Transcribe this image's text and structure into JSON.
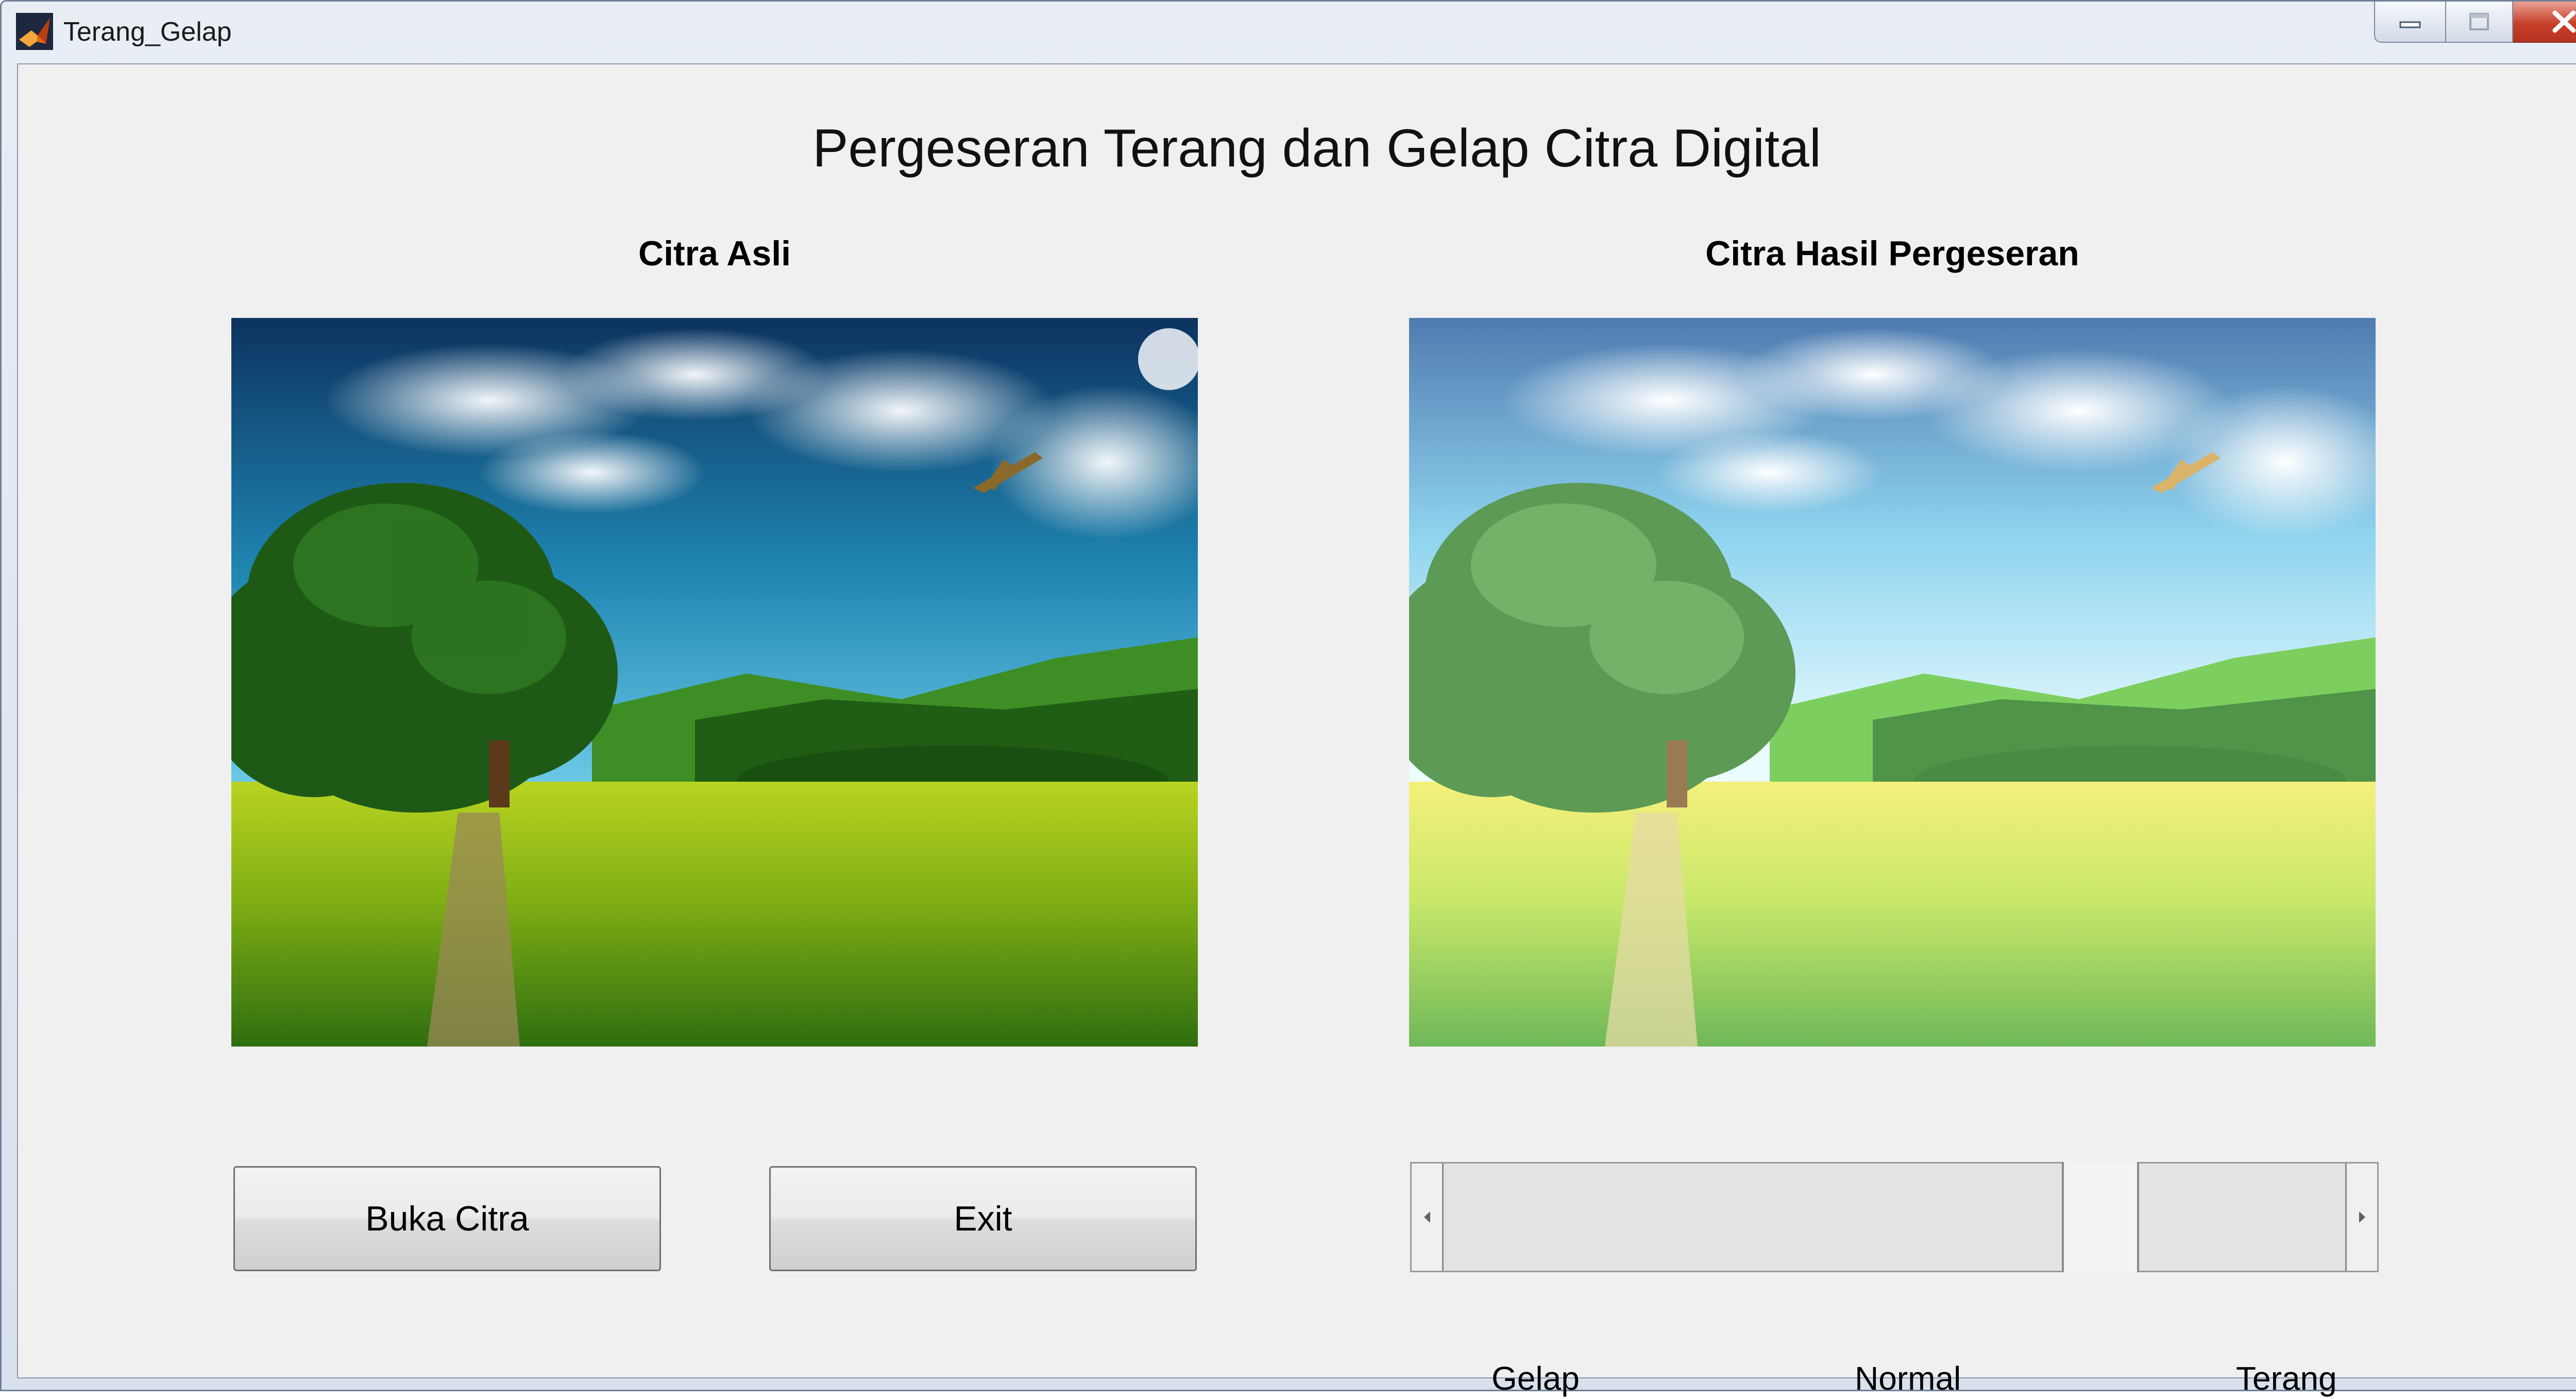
{
  "window": {
    "title": "Terang_Gelap",
    "icon": "matlab-icon"
  },
  "header": {
    "title": "Pergeseran Terang dan Gelap Citra Digital"
  },
  "panels": {
    "original_label": "Citra Asli",
    "result_label": "Citra Hasil Pergeseran"
  },
  "buttons": {
    "open_label": "Buka Citra",
    "exit_label": "Exit"
  },
  "slider": {
    "value_fraction": 0.75,
    "labels": {
      "dark": "Gelap",
      "normal": "Normal",
      "bright": "Terang"
    }
  },
  "colors": {
    "close_button": "#c8402a",
    "client_background": "#f0f0f0"
  }
}
